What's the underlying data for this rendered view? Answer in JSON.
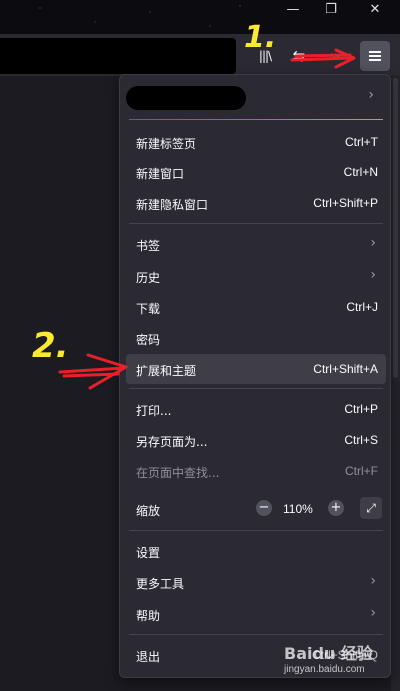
{
  "window": {
    "minimize": "—",
    "restore": "❐",
    "close": "✕"
  },
  "toolbar": {
    "library_icon": "|||\\",
    "sync_icon": "⇆",
    "overflow_icon": "»"
  },
  "menu": {
    "profile_chevron": "›",
    "items": [
      {
        "label": "新建标签页",
        "shortcut": "Ctrl+T"
      },
      {
        "label": "新建窗口",
        "shortcut": "Ctrl+N"
      },
      {
        "label": "新建隐私窗口",
        "shortcut": "Ctrl+Shift+P"
      },
      {
        "label": "书签",
        "shortcut": ""
      },
      {
        "label": "历史",
        "shortcut": ""
      },
      {
        "label": "下载",
        "shortcut": "Ctrl+J"
      },
      {
        "label": "密码",
        "shortcut": ""
      },
      {
        "label": "扩展和主题",
        "shortcut": "Ctrl+Shift+A"
      },
      {
        "label": "打印...",
        "shortcut": "Ctrl+P"
      },
      {
        "label": "另存页面为...",
        "shortcut": "Ctrl+S"
      },
      {
        "label": "在页面中查找...",
        "shortcut": "Ctrl+F"
      },
      {
        "label": "设置",
        "shortcut": ""
      },
      {
        "label": "更多工具",
        "shortcut": ""
      },
      {
        "label": "帮助",
        "shortcut": ""
      },
      {
        "label": "退出",
        "shortcut": "Ctrl+Shift+Q"
      }
    ],
    "zoom": {
      "label": "缩放",
      "minus": "−",
      "value": "110%",
      "plus": "+",
      "fullscreen": "⤢"
    }
  },
  "annotations": {
    "step1": "1.",
    "step2": "2."
  },
  "watermark": {
    "brand": "Baidu 经验",
    "url": "jingyan.baidu.com"
  },
  "colors": {
    "accent_start": "#6e48d8",
    "accent_end": "#ff7a6a",
    "annotation_red": "#e8202a",
    "annotation_yellow": "#ffe830"
  }
}
